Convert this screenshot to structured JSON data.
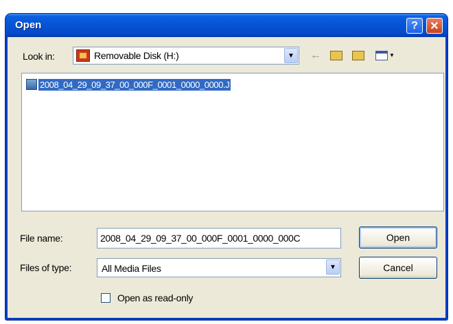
{
  "window": {
    "title": "Open",
    "help_glyph": "?",
    "close_glyph": "✕"
  },
  "toolbar": {
    "look_in_label": "Look in:",
    "look_in_value": "Removable Disk (H:)",
    "back_icon": "←"
  },
  "files": [
    {
      "name": "2008_04_29_09_37_00_000F_0001_0000_0000.J",
      "selected": true
    }
  ],
  "form": {
    "file_name_label": "File name:",
    "file_name_value": "2008_04_29_09_37_00_000F_0001_0000_000C",
    "files_of_type_label": "Files of type:",
    "files_of_type_value": "All Media Files",
    "readonly_label": "Open as read-only",
    "readonly_checked": false
  },
  "buttons": {
    "open_label": "Open",
    "cancel_label": "Cancel"
  },
  "colors": {
    "titlebar": "#0653d6",
    "selection": "#316ac5",
    "dialog_bg": "#ece9d8"
  }
}
